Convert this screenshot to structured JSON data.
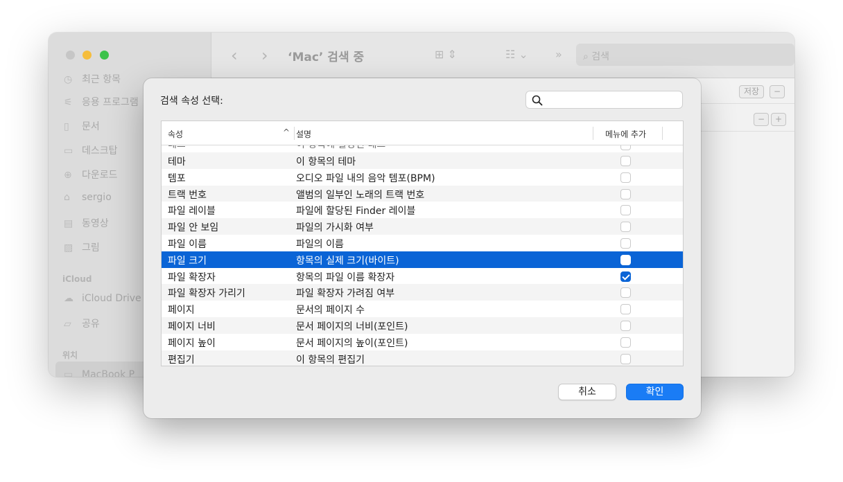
{
  "finder": {
    "title": "‘Mac’ 검색 중",
    "search_placeholder": "검색",
    "sidebar_items": [
      {
        "label": "최근 항목",
        "icon": "clock-icon"
      },
      {
        "label": "응용 프로그램",
        "icon": "apps-icon"
      },
      {
        "label": "문서",
        "icon": "document-icon"
      },
      {
        "label": "데스크탑",
        "icon": "desktop-icon"
      },
      {
        "label": "다운로드",
        "icon": "download-icon"
      },
      {
        "label": "sergio",
        "icon": "home-icon"
      },
      {
        "label": "동영상",
        "icon": "film-icon"
      },
      {
        "label": "그림",
        "icon": "picture-icon"
      }
    ],
    "section_icloud": "iCloud",
    "icloud_items": [
      {
        "label": "iCloud Drive",
        "icon": "cloud-icon"
      },
      {
        "label": "공유",
        "icon": "shared-folder-icon"
      }
    ],
    "section_locations": "위치",
    "location_item": "MacBook P",
    "save_label": "저장",
    "minus_label": "−",
    "plus_label": "+"
  },
  "dialog": {
    "title": "검색 속성 선택:",
    "search_value": "",
    "columns": {
      "attribute": "속성",
      "description": "설명",
      "add_to_menu": "메뉴에 추가"
    },
    "partial_row": {
      "attribute": "테그",
      "description": "이 항목에 할당된 태그"
    },
    "rows": [
      {
        "attribute": "테마",
        "description": "이 항목의 테마",
        "checked": false,
        "selected": false
      },
      {
        "attribute": "템포",
        "description": "오디오 파일 내의 음악 템포(BPM)",
        "checked": false,
        "selected": false
      },
      {
        "attribute": "트랙 번호",
        "description": "앨범의 일부인 노래의 트랙 번호",
        "checked": false,
        "selected": false
      },
      {
        "attribute": "파일 레이블",
        "description": "파일에 할당된 Finder 레이블",
        "checked": false,
        "selected": false
      },
      {
        "attribute": "파일 안 보임",
        "description": "파일의 가시화 여부",
        "checked": false,
        "selected": false
      },
      {
        "attribute": "파일 이름",
        "description": "파일의 이름",
        "checked": false,
        "selected": false
      },
      {
        "attribute": "파일 크기",
        "description": "항목의 실제 크기(바이트)",
        "checked": false,
        "selected": true
      },
      {
        "attribute": "파일 확장자",
        "description": "항목의 파일 이름 확장자",
        "checked": true,
        "selected": false
      },
      {
        "attribute": "파일 확장자 가리기",
        "description": "파일 확장자 가려짐 여부",
        "checked": false,
        "selected": false
      },
      {
        "attribute": "페이지",
        "description": "문서의 페이지 수",
        "checked": false,
        "selected": false
      },
      {
        "attribute": "페이지 너비",
        "description": "문서 페이지의 너비(포인트)",
        "checked": false,
        "selected": false
      },
      {
        "attribute": "페이지 높이",
        "description": "문서 페이지의 높이(포인트)",
        "checked": false,
        "selected": false
      },
      {
        "attribute": "편집기",
        "description": "이 항목의 편집기",
        "checked": false,
        "selected": false
      }
    ],
    "cancel_label": "취소",
    "ok_label": "확인"
  },
  "colors": {
    "accent": "#0a64d6",
    "ok_button": "#1a7cf5"
  }
}
